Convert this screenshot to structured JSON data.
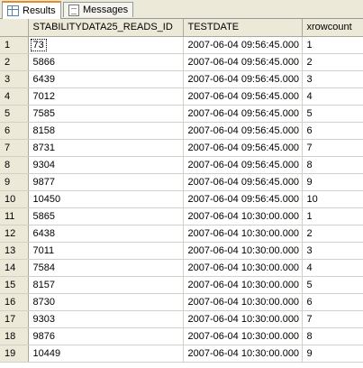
{
  "tabs": [
    {
      "label": "Results",
      "icon": "results-grid-icon",
      "active": true
    },
    {
      "label": "Messages",
      "icon": "messages-icon",
      "active": false
    }
  ],
  "grid": {
    "columns": [
      "",
      "STABILITYDATA25_READS_ID",
      "TESTDATE",
      "xrowcount"
    ],
    "rows": [
      [
        "1",
        "73",
        "2007-06-04 09:56:45.000",
        "1"
      ],
      [
        "2",
        "5866",
        "2007-06-04 09:56:45.000",
        "2"
      ],
      [
        "3",
        "6439",
        "2007-06-04 09:56:45.000",
        "3"
      ],
      [
        "4",
        "7012",
        "2007-06-04 09:56:45.000",
        "4"
      ],
      [
        "5",
        "7585",
        "2007-06-04 09:56:45.000",
        "5"
      ],
      [
        "6",
        "8158",
        "2007-06-04 09:56:45.000",
        "6"
      ],
      [
        "7",
        "8731",
        "2007-06-04 09:56:45.000",
        "7"
      ],
      [
        "8",
        "9304",
        "2007-06-04 09:56:45.000",
        "8"
      ],
      [
        "9",
        "9877",
        "2007-06-04 09:56:45.000",
        "9"
      ],
      [
        "10",
        "10450",
        "2007-06-04 09:56:45.000",
        "10"
      ],
      [
        "11",
        "5865",
        "2007-06-04 10:30:00.000",
        "1"
      ],
      [
        "12",
        "6438",
        "2007-06-04 10:30:00.000",
        "2"
      ],
      [
        "13",
        "7011",
        "2007-06-04 10:30:00.000",
        "3"
      ],
      [
        "14",
        "7584",
        "2007-06-04 10:30:00.000",
        "4"
      ],
      [
        "15",
        "8157",
        "2007-06-04 10:30:00.000",
        "5"
      ],
      [
        "16",
        "8730",
        "2007-06-04 10:30:00.000",
        "6"
      ],
      [
        "17",
        "9303",
        "2007-06-04 10:30:00.000",
        "7"
      ],
      [
        "18",
        "9876",
        "2007-06-04 10:30:00.000",
        "8"
      ],
      [
        "19",
        "10449",
        "2007-06-04 10:30:00.000",
        "9"
      ]
    ]
  }
}
